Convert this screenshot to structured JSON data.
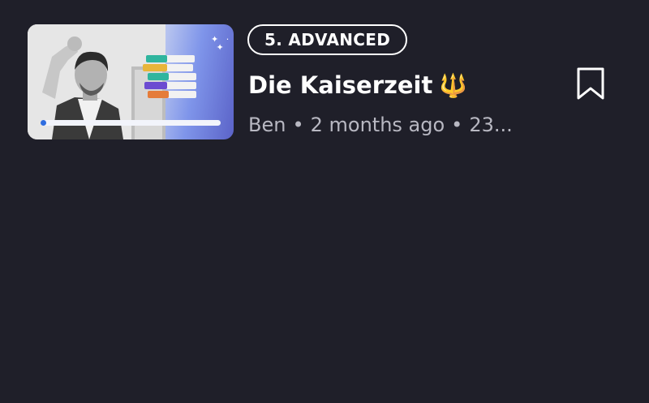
{
  "episode": {
    "level_badge": "5. ADVANCED",
    "title": "Die Kaiserzeit",
    "title_emoji": "🔱",
    "author": "Ben",
    "published": "2 months ago",
    "duration": "23...",
    "separator": "•",
    "watch_progress": 0.03,
    "thumbnail": {
      "icon": "books-stack-icon",
      "accent_colors": [
        "#e7e7e7",
        "#5b63c8",
        "#2e6de0"
      ]
    },
    "bookmark_icon": "bookmark-icon"
  }
}
